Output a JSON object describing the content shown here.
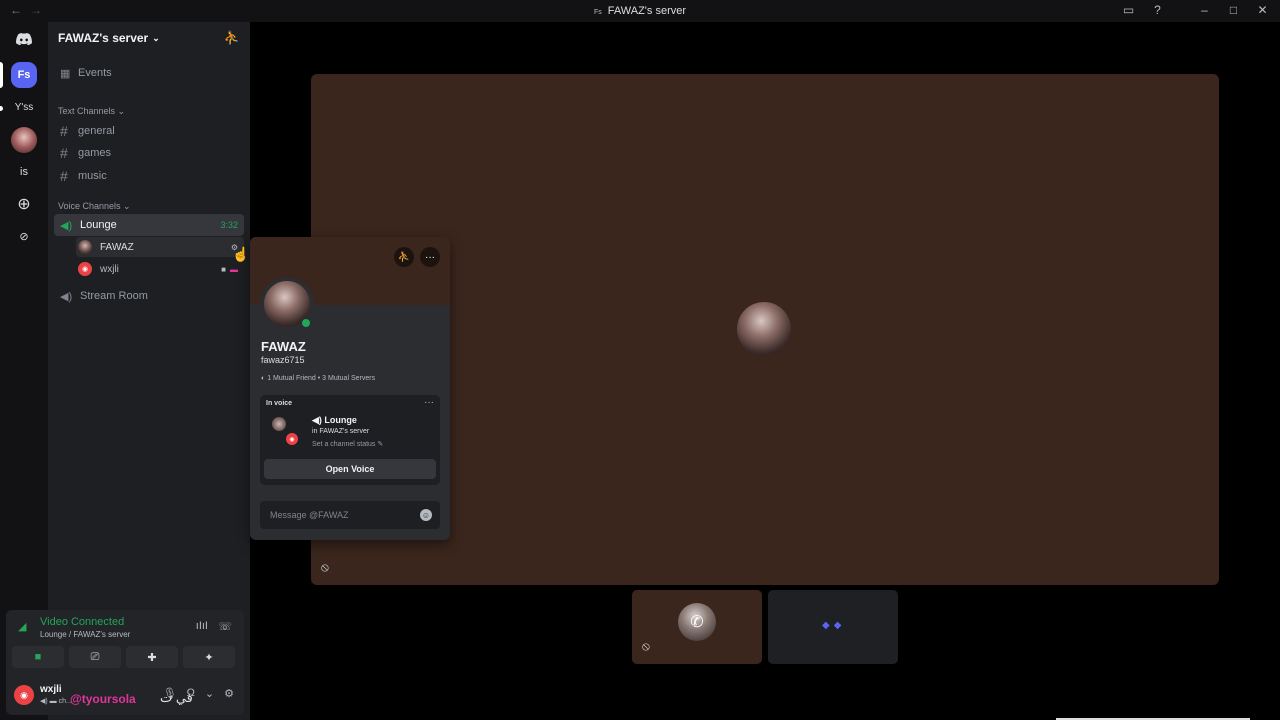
{
  "window": {
    "title": "FAWAZ's server",
    "title_badge": "Fs"
  },
  "guilds": [
    {
      "label": "Fs"
    },
    {
      "label": "Y'ss"
    },
    {
      "label": "is"
    }
  ],
  "server": {
    "name": "FAWAZ's server"
  },
  "channels": {
    "events": "Events",
    "text_category": "Text Channels",
    "text": [
      "general",
      "games",
      "music"
    ],
    "voice_category": "Voice Channels",
    "lounge": {
      "name": "Lounge",
      "time": "3:32"
    },
    "lounge_users": [
      "FAWAZ",
      "wxjli"
    ],
    "stream_room": "Stream Room"
  },
  "voice_panel": {
    "status": "Video Connected",
    "location": "Lounge / FAWAZ's server"
  },
  "user_panel": {
    "name": "wxjli",
    "status": "ch..."
  },
  "overlay": {
    "text": "@tyoursola",
    "arabic": "في ت"
  },
  "popout": {
    "name": "FAWAZ",
    "handle": "fawaz6715",
    "mutual": "1 Mutual Friend • 3 Mutual Servers",
    "in_voice_label": "In voice",
    "channel": "Lounge",
    "server": "in FAWAZ's server",
    "channel_status": "Set a channel status",
    "open_voice": "Open Voice",
    "message_placeholder": "Message @FAWAZ"
  },
  "colors": {
    "accent": "#5865f2",
    "online": "#23a55a",
    "banner": "#3a261d",
    "danger": "#ed4245"
  }
}
